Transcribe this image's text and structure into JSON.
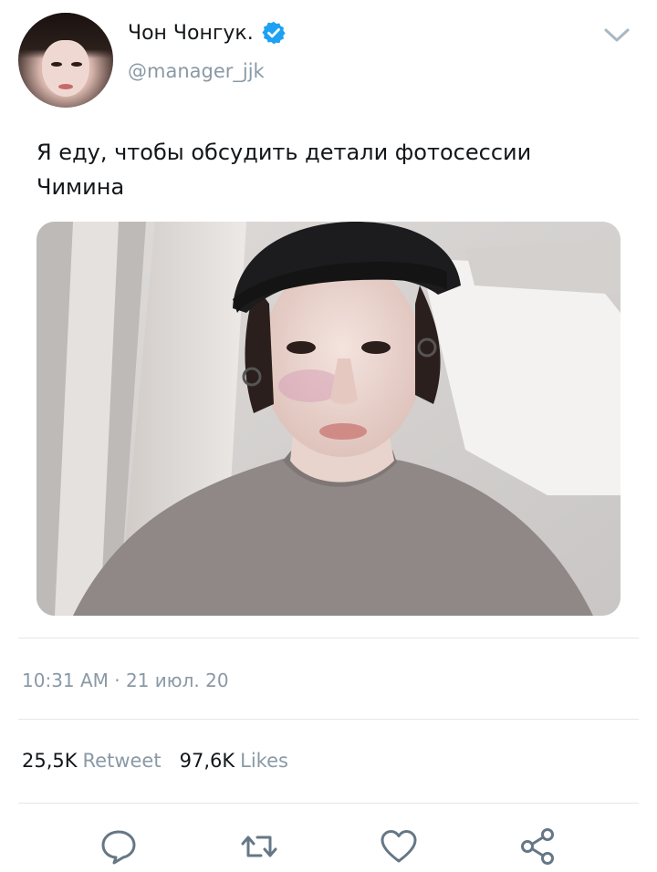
{
  "tweet": {
    "author": {
      "display_name": "Чон Чонгук.",
      "handle": "@manager_jjk",
      "verified": true
    },
    "text_line1": "Я еду, чтобы обсудить детали фотосессии",
    "text_line2": "Чимина",
    "media": {
      "alt": ""
    },
    "timestamp": "10:31 AM · 21 июл. 20",
    "stats": {
      "retweets": "25,5K",
      "retweets_label": "Retweet",
      "likes": "97,6K",
      "likes_label": "Likes"
    }
  },
  "icons": {
    "verified": "verified-badge-icon",
    "menu": "chevron-down-icon",
    "reply": "reply-icon",
    "retweet": "retweet-icon",
    "like": "heart-icon",
    "share": "share-icon"
  },
  "colors": {
    "verified_blue": "#1da1f2",
    "secondary_text": "#8a99a6",
    "primary_text": "#14171a",
    "icon_gray": "#657786",
    "divider": "#e1e8ed"
  }
}
